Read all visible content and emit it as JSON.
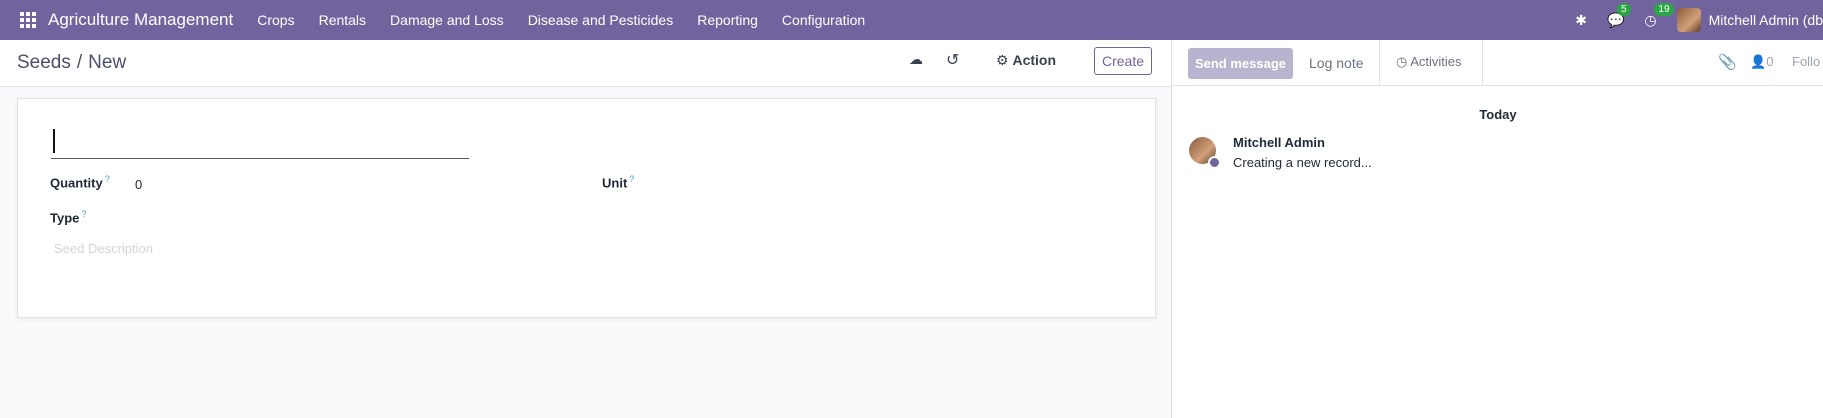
{
  "topbar": {
    "brand": "Agriculture Management",
    "menu": [
      "Crops",
      "Rentals",
      "Damage and Loss",
      "Disease and Pesticides",
      "Reporting",
      "Configuration"
    ],
    "messages_count": "5",
    "activities_count": "19",
    "user": "Mitchell Admin (db"
  },
  "control": {
    "breadcrumb_parent": "Seeds",
    "breadcrumb_sep": "/",
    "breadcrumb_current": "New",
    "action_label": "Action",
    "create_label": "Create"
  },
  "form": {
    "quantity_label": "Quantity",
    "quantity_value": "0",
    "unit_label": "Unit",
    "type_label": "Type",
    "help_mark": "?",
    "description_placeholder": "Seed Description"
  },
  "chatter": {
    "send_message": "Send message",
    "log_note": "Log note",
    "activities": "Activities",
    "followers_count": "0",
    "follow": "Follo",
    "today": "Today",
    "author": "Mitchell Admin",
    "message": "Creating a new record..."
  },
  "colors": {
    "brand": "#71639e",
    "badge": "#28a745"
  }
}
